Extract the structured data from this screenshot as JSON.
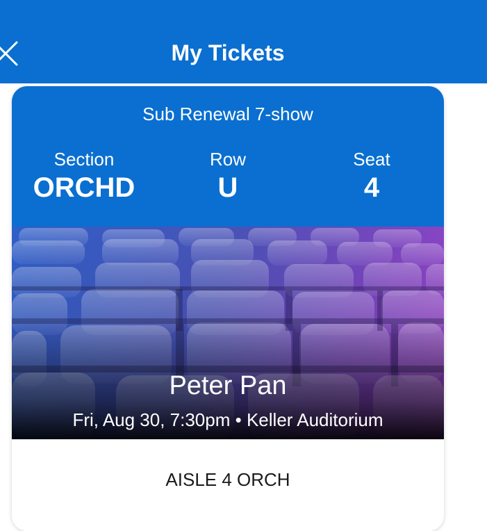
{
  "header": {
    "title": "My Tickets",
    "close_icon": "close-icon",
    "background_color": "#0a6fd0"
  },
  "ticket": {
    "type": "Sub Renewal 7-show",
    "section": {
      "label": "Section",
      "value": "ORCHD"
    },
    "row": {
      "label": "Row",
      "value": "U"
    },
    "seat": {
      "label": "Seat",
      "value": "4"
    },
    "event": {
      "name": "Peter Pan",
      "date_time": "Fri, Aug 30, 7:30pm",
      "separator": "•",
      "venue": "Keller Auditorium"
    },
    "entry_info": "AISLE 4 ORCH"
  }
}
